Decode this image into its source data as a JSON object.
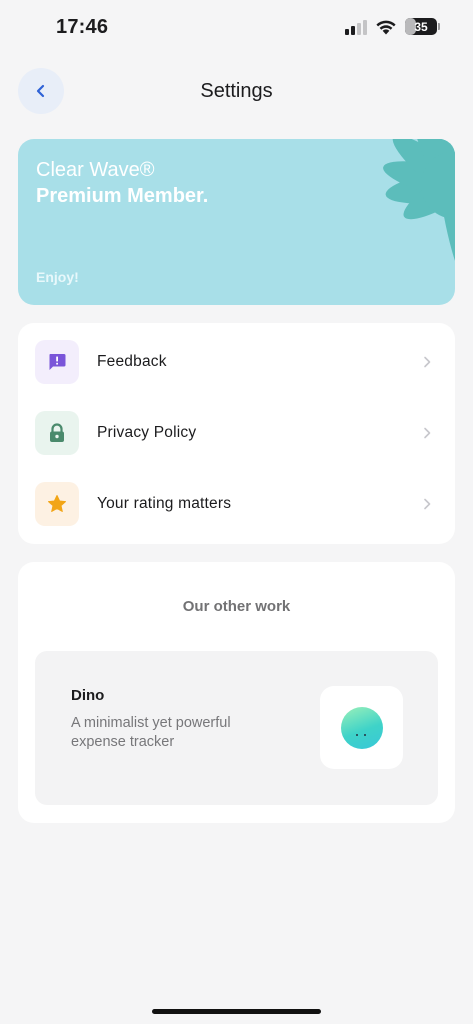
{
  "status_bar": {
    "time": "17:46",
    "battery": "35"
  },
  "header": {
    "title": "Settings"
  },
  "banner": {
    "brand": "Clear Wave®",
    "member": "Premium Member.",
    "tagline": "Enjoy!",
    "color": "#a8dfe8"
  },
  "menu": {
    "items": [
      {
        "label": "Feedback",
        "icon": "feedback-icon",
        "icon_color": "#7a55d9",
        "bg": "#f3eefc"
      },
      {
        "label": "Privacy Policy",
        "icon": "lock-icon",
        "icon_color": "#4a8a6c",
        "bg": "#e9f4ee"
      },
      {
        "label": "Your rating matters",
        "icon": "star-icon",
        "icon_color": "#f2a516",
        "bg": "#fdf1e3"
      }
    ]
  },
  "other_work": {
    "title": "Our other work",
    "app": {
      "name": "Dino",
      "description": "A minimalist yet powerful expense tracker"
    }
  }
}
